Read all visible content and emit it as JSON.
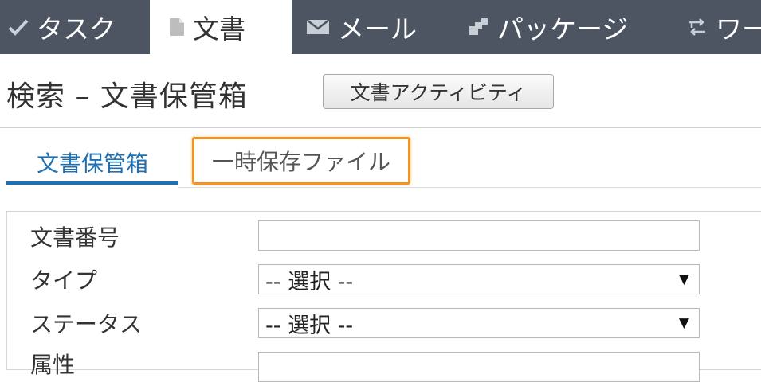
{
  "top_nav": {
    "tabs": [
      {
        "label": "タスク",
        "icon": "check-icon",
        "active": false
      },
      {
        "label": "文書",
        "icon": "document-icon",
        "active": true
      },
      {
        "label": "メール",
        "icon": "envelope-icon",
        "active": false
      },
      {
        "label": "パッケージ",
        "icon": "package-icon",
        "active": false
      },
      {
        "label": "ワー",
        "icon": "workflow-icon",
        "active": false
      }
    ]
  },
  "header": {
    "title": "検索 – 文書保管箱",
    "activity_button": "文書アクティビティ"
  },
  "sub_tabs": [
    {
      "label": "文書保管箱",
      "active": true
    },
    {
      "label": "一時保存ファイル",
      "active": false,
      "highlighted": true
    }
  ],
  "search_form": {
    "fields": [
      {
        "label": "文書番号",
        "type": "text",
        "value": ""
      },
      {
        "label": "タイプ",
        "type": "select",
        "value": "-- 選択 --"
      },
      {
        "label": "ステータス",
        "type": "select",
        "value": "-- 選択 --"
      },
      {
        "label": "属性",
        "type": "select",
        "value": ""
      }
    ]
  },
  "colors": {
    "nav_background": "#4d5563",
    "active_subtab": "#1f6fb3",
    "highlight_border": "#f39322"
  }
}
